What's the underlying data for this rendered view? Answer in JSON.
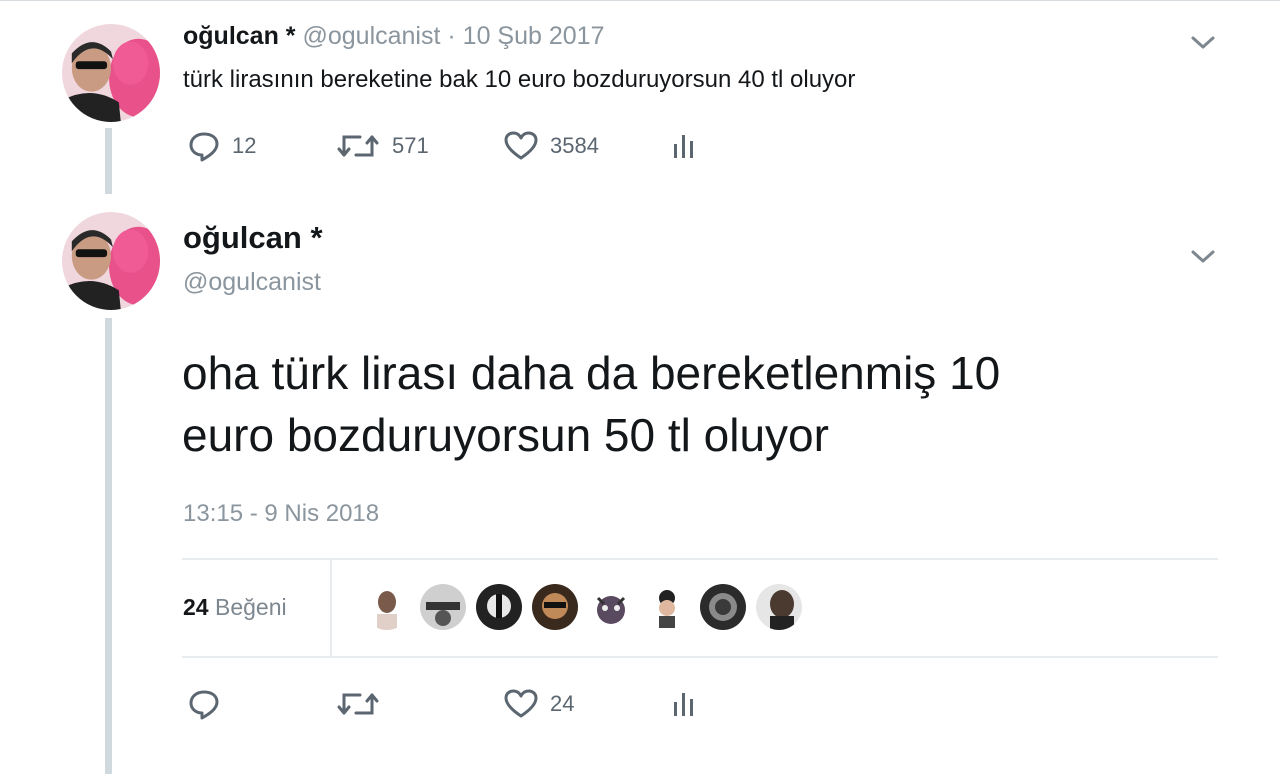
{
  "tweet1": {
    "name": "oğulcan",
    "star": "*",
    "handle": "@ogulcanist",
    "separator": "·",
    "date": "10 Şub 2017",
    "text": "türk lirasının bereketine bak 10 euro bozduruyorsun 40 tl oluyor",
    "replies": "12",
    "retweets": "571",
    "likes": "3584"
  },
  "tweet2": {
    "name": "oğulcan",
    "star": "*",
    "handle": "@ogulcanist",
    "text_line1": "oha türk lirası daha da bereketlenmiş 10",
    "text_line2": "euro bozduruyorsun 50 tl oluyor",
    "timestamp": "13:15 - 9 Nis 2018",
    "likes_count": "24",
    "likes_label": "Beğeni",
    "action_likes": "24"
  },
  "colors": {
    "text": "#14171a",
    "muted": "#8a959e",
    "thread_line": "#cfd9de",
    "divider": "#e8ecee"
  },
  "icons": [
    "chevron-down-icon",
    "reply-icon",
    "retweet-icon",
    "heart-icon",
    "analytics-icon"
  ]
}
